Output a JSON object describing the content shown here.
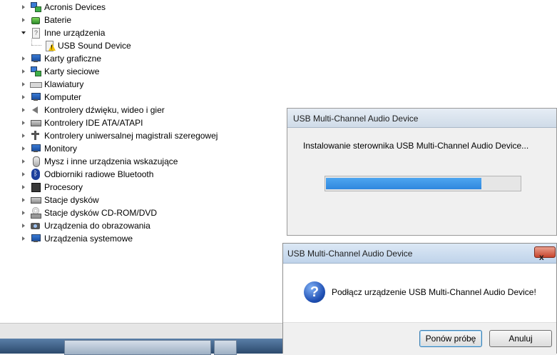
{
  "tree": {
    "items": [
      {
        "label": "Acronis Devices",
        "icon": "network-icon",
        "expanded": false
      },
      {
        "label": "Baterie",
        "icon": "battery-icon",
        "expanded": false
      },
      {
        "label": "Inne urządzenia",
        "icon": "unknown-device-icon",
        "expanded": true
      },
      {
        "label": "USB Sound Device",
        "icon": "warning-device-icon",
        "child": true
      },
      {
        "label": "Karty graficzne",
        "icon": "display-adapter-icon",
        "expanded": false
      },
      {
        "label": "Karty sieciowe",
        "icon": "network-adapter-icon",
        "expanded": false
      },
      {
        "label": "Klawiatury",
        "icon": "keyboard-icon",
        "expanded": false
      },
      {
        "label": "Komputer",
        "icon": "computer-icon",
        "expanded": false
      },
      {
        "label": "Kontrolery dźwięku, wideo i gier",
        "icon": "speaker-icon",
        "expanded": false
      },
      {
        "label": "Kontrolery IDE ATA/ATAPI",
        "icon": "ide-controller-icon",
        "expanded": false
      },
      {
        "label": "Kontrolery uniwersalnej magistrali szeregowej",
        "icon": "usb-icon",
        "expanded": false
      },
      {
        "label": "Monitory",
        "icon": "monitor-icon",
        "expanded": false
      },
      {
        "label": "Mysz i inne urządzenia wskazujące",
        "icon": "mouse-icon",
        "expanded": false
      },
      {
        "label": "Odbiorniki radiowe Bluetooth",
        "icon": "bluetooth-icon",
        "expanded": false
      },
      {
        "label": "Procesory",
        "icon": "processor-icon",
        "expanded": false
      },
      {
        "label": "Stacje dysków",
        "icon": "disk-drive-icon",
        "expanded": false
      },
      {
        "label": "Stacje dysków CD-ROM/DVD",
        "icon": "cdrom-icon",
        "expanded": false
      },
      {
        "label": "Urządzenia do obrazowania",
        "icon": "camera-icon",
        "expanded": false
      },
      {
        "label": "Urządzenia systemowe",
        "icon": "system-device-icon",
        "expanded": false
      }
    ]
  },
  "progress_dialog": {
    "title": "USB Multi-Channel Audio Device",
    "message": "Instalowanie sterownika USB Multi-Channel Audio Device...",
    "progress_fraction": 0.8
  },
  "prompt_dialog": {
    "title": "USB Multi-Channel Audio Device",
    "close_label": "x",
    "icon": "question-icon",
    "message": "Podłącz urządzenie USB Multi-Channel Audio Device!",
    "retry_label": "Ponów próbę",
    "cancel_label": "Anuluj"
  },
  "colors": {
    "progress_fill": "#3a95e6",
    "close_button": "#c7442c"
  }
}
